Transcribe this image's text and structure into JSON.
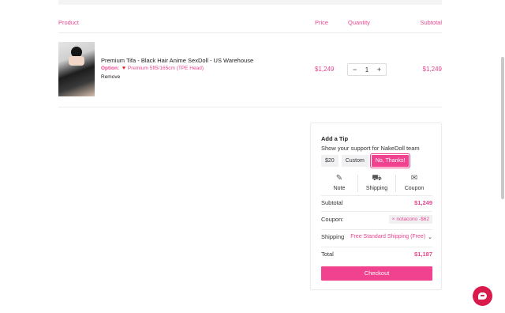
{
  "cart_header": {
    "product": "Product",
    "price": "Price",
    "quantity": "Quantity",
    "subtotal": "Subtotal"
  },
  "item": {
    "name": "Premium Tifa - Black Hair Anime SexDoll - US Warehouse",
    "option_label": "Option:",
    "option_value": "Premium 5ft5/165cm (TPE Head)",
    "remove": "Remove",
    "price": "$1,249",
    "quantity": "1",
    "qty_minus": "−",
    "qty_plus": "+",
    "subtotal": "$1,249"
  },
  "summary": {
    "tip_title": "Add a Tip",
    "tip_subtitle": "Show your support for NakeDoll team",
    "tip_options": [
      "$20",
      "Custom",
      "No, Thanks!"
    ],
    "actions": [
      {
        "label": "Note",
        "icon": "pencil-icon"
      },
      {
        "label": "Shipping",
        "icon": "truck-icon"
      },
      {
        "label": "Coupon",
        "icon": "ticket-icon"
      }
    ],
    "subtotal_label": "Subtotal",
    "subtotal_value": "$1,249",
    "coupon_label": "Coupon:",
    "coupon_code": "notacono",
    "coupon_amount": "-$62",
    "coupon_remove": "×",
    "shipping_label": "Shipping",
    "shipping_value": "Free Standard Shipping (Free)",
    "total_label": "Total",
    "total_value": "$1,187",
    "checkout": "Checkout"
  },
  "colors": {
    "accent": "#f0428e",
    "accent_text": "#e8458f",
    "chat": "#d81a4c"
  }
}
